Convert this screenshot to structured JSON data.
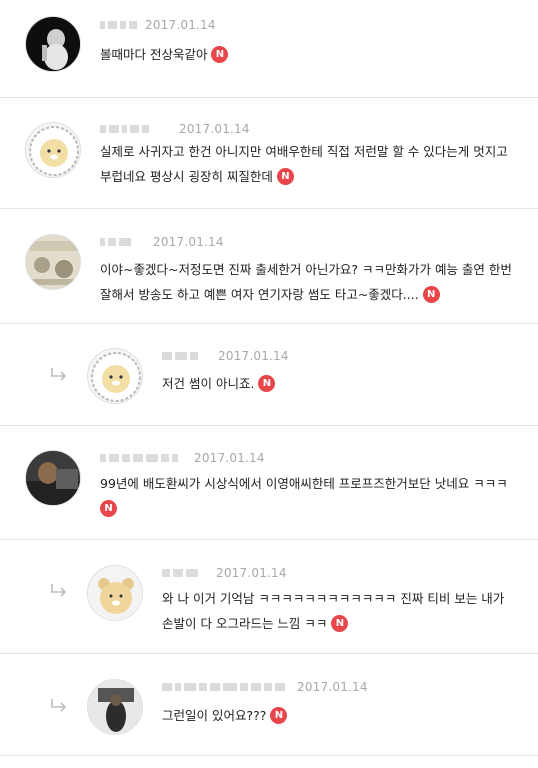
{
  "badge_label": "N",
  "comments": [
    {
      "date": "2017.01.14",
      "text": "볼때마다 전상욱같아"
    },
    {
      "date": "2017.01.14",
      "text": "실제로 사귀자고 한건 아니지만 여배우한테 직접 저런말 할 수 있다는게 멋지고 부럽네요 평상시 굉장히 찌질한데"
    },
    {
      "date": "2017.01.14",
      "text": "이야~좋겠다~저정도면 진짜 출세한거 아닌가요? ㅋㅋ만화가가 예능 출연 한번 잘해서 방송도 하고 예쁜 여자 연기자랑 썸도 타고~좋겠다...."
    },
    {
      "date": "2017.01.14",
      "text": "저건 썸이 아니죠."
    },
    {
      "date": "2017.01.14",
      "text": "99년에 배도환씨가 시상식에서 이영애씨한테 프로프즈한거보단 낫네요 ㅋㅋㅋ"
    },
    {
      "date": "2017.01.14",
      "text": "와 나 이거 기억남 ㅋㅋㅋㅋㅋㅋㅋㅋㅋㅋㅋㅋ 진짜 티비 보는 내가 손발이 다 오그라드는 느낌 ㅋㅋ"
    },
    {
      "date": "2017.01.14",
      "text": "그런일이 있어요???"
    }
  ]
}
